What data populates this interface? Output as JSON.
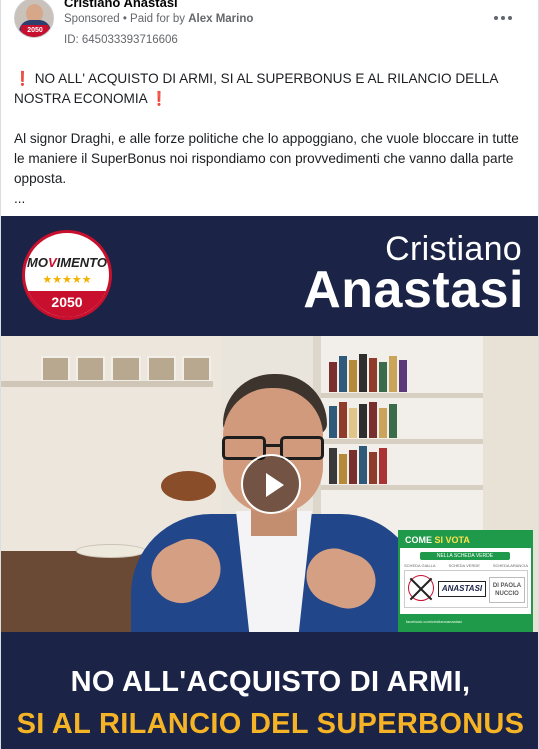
{
  "post": {
    "page_name": "Cristiano Anastasi",
    "sponsored_label": "Sponsored",
    "separator": " • ",
    "paid_for_prefix": "Paid for by ",
    "paid_for_name": "Alex Marino",
    "ad_id": "ID: 645033393716606",
    "avatar_badge": "2050",
    "more_icon": "more-horizontal-icon"
  },
  "text": {
    "excl_icon": "❗",
    "headline": " NO ALL' ACQUISTO DI ARMI, SI AL SUPERBONUS E AL RILANCIO DELLA NOSTRA ECONOMIA ",
    "body": "Al signor Draghi, e alle forze politiche che lo appoggiano, che vuole bloccare in tutte le maniere il SuperBonus noi rispondiamo con provvedimenti che vanno dalla parte opposta.",
    "ellipsis": "..."
  },
  "media": {
    "logo_brand_1": "MO",
    "logo_brand_2": "V",
    "logo_brand_3": "IMENTO",
    "logo_stars": "★★★★★",
    "logo_year": "2050",
    "name_first": "Cristiano",
    "name_last": "Anastasi",
    "play_icon": "play-icon",
    "vote_card": {
      "head_1": "COME ",
      "head_2": "SI VOTA",
      "sub": "NELLA SCHEDA VERDE",
      "label_1": "SCHEDA GIALLA",
      "label_2": "SCHEDA VERDE",
      "label_3": "SCHEDA ARANCIA",
      "candidate": "ANASTASI",
      "candidate_2": "DI PAOLA NUCCIO",
      "foot": "facebook.com/cristianoanastasi"
    },
    "banner_line_1": "NO ALL'ACQUISTO DI ARMI,",
    "banner_line_2": "SI AL RILANCIO DEL SUPERBONUS",
    "colors": {
      "navy": "#1b2346",
      "accent_yellow": "#f5b326",
      "brand_red": "#c8102e",
      "vote_green": "#1f9a4a"
    }
  }
}
